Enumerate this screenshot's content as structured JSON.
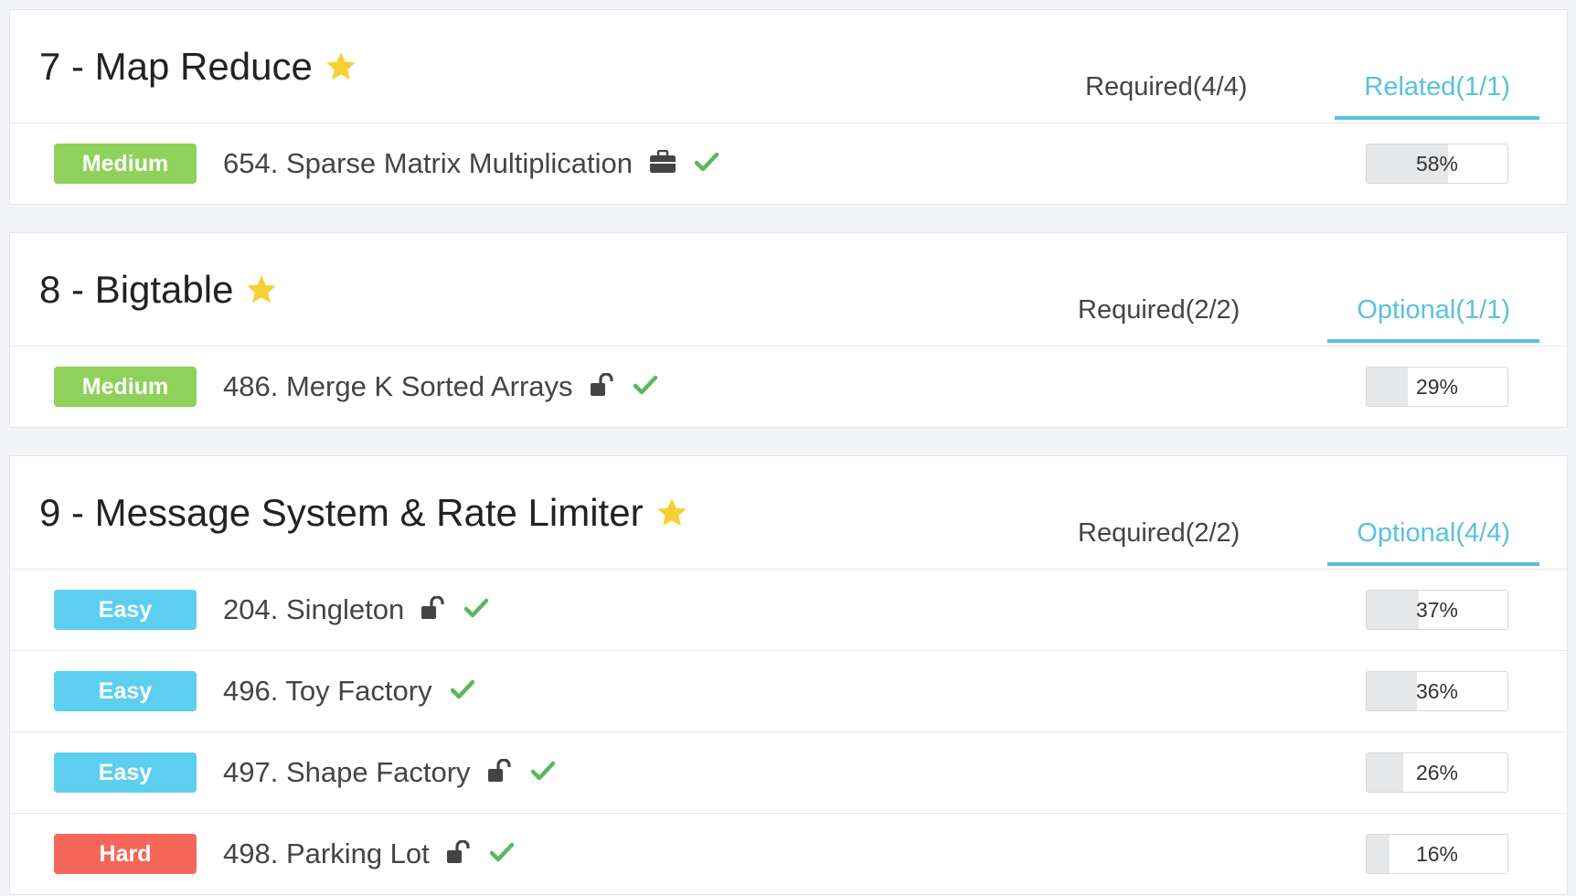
{
  "colors": {
    "accent": "#5bc0de",
    "medium": "#8fd15b",
    "easy": "#5ccff0",
    "hard": "#f6675a",
    "check": "#5cb85c",
    "star": "#f7d035"
  },
  "sections": [
    {
      "title": "7 - Map Reduce",
      "tab_inactive": "Required(4/4)",
      "tab_active": "Related(1/1)",
      "problems": [
        {
          "difficulty": "Medium",
          "title": "654. Sparse Matrix Multiplication",
          "icon": "briefcase-icon",
          "completed": true,
          "progress": 0.58,
          "progress_label": "58%"
        }
      ]
    },
    {
      "title": "8 - Bigtable",
      "tab_inactive": "Required(2/2)",
      "tab_active": "Optional(1/1)",
      "problems": [
        {
          "difficulty": "Medium",
          "title": "486. Merge K Sorted Arrays",
          "icon": "unlock-icon",
          "completed": true,
          "progress": 0.29,
          "progress_label": "29%"
        }
      ]
    },
    {
      "title": "9 - Message System & Rate Limiter",
      "tab_inactive": "Required(2/2)",
      "tab_active": "Optional(4/4)",
      "problems": [
        {
          "difficulty": "Easy",
          "title": "204. Singleton",
          "icon": "unlock-icon",
          "completed": true,
          "progress": 0.37,
          "progress_label": "37%"
        },
        {
          "difficulty": "Easy",
          "title": "496. Toy Factory",
          "icon": "",
          "completed": true,
          "progress": 0.36,
          "progress_label": "36%"
        },
        {
          "difficulty": "Easy",
          "title": "497. Shape Factory",
          "icon": "unlock-icon",
          "completed": true,
          "progress": 0.26,
          "progress_label": "26%"
        },
        {
          "difficulty": "Hard",
          "title": "498. Parking Lot",
          "icon": "unlock-icon",
          "completed": true,
          "progress": 0.16,
          "progress_label": "16%"
        }
      ]
    }
  ]
}
